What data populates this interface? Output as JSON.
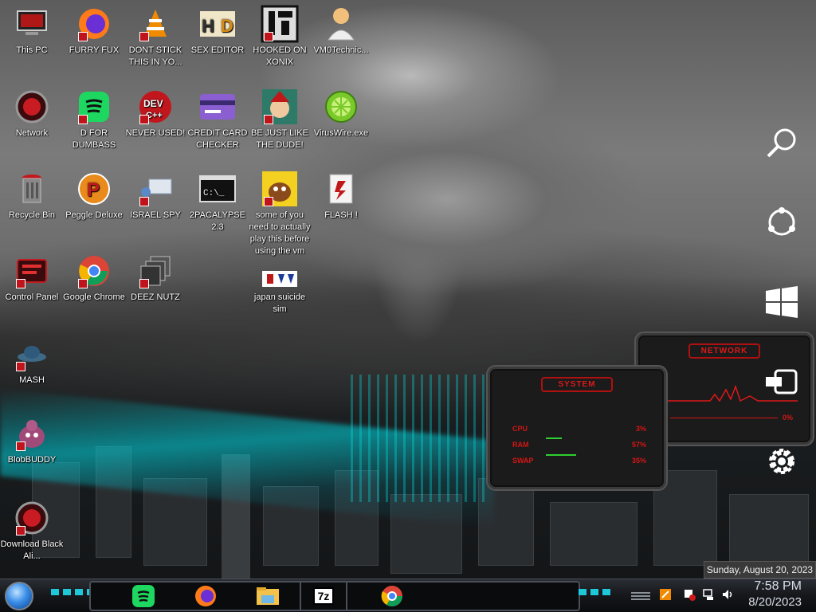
{
  "desktop_icons": [
    {
      "id": "this-pc",
      "label": "This PC"
    },
    {
      "id": "furry-fux",
      "label": "FURRY FUX"
    },
    {
      "id": "dont-stick",
      "label": "DONT STICK THIS IN YO..."
    },
    {
      "id": "sex-editor",
      "label": "SEX EDITOR"
    },
    {
      "id": "hooked-on-xonix",
      "label": "HOOKED ON XONIX"
    },
    {
      "id": "vm0technic",
      "label": "VM0Technic..."
    },
    {
      "id": "network",
      "label": "Network"
    },
    {
      "id": "d-for-dumbass",
      "label": "D FOR DUMBASS"
    },
    {
      "id": "never-used",
      "label": "NEVER USED!"
    },
    {
      "id": "credit-card-checker",
      "label": "CREDIT CARD CHECKER"
    },
    {
      "id": "be-just-like-the-dude",
      "label": "BE JUST LIKE THE DUDE!"
    },
    {
      "id": "viruswire",
      "label": "VirusWire.exe"
    },
    {
      "id": "recycle-bin",
      "label": "Recycle Bin"
    },
    {
      "id": "peggle-deluxe",
      "label": "Peggle Deluxe"
    },
    {
      "id": "israel-spy",
      "label": "ISRAEL SPY"
    },
    {
      "id": "2pacalypse",
      "label": "2PACALYPSE 2.3"
    },
    {
      "id": "some-of-you",
      "label": "some of you need to actually play this before using the vm"
    },
    {
      "id": "flash",
      "label": "FLASH !"
    },
    {
      "id": "control-panel",
      "label": "Control Panel"
    },
    {
      "id": "google-chrome",
      "label": "Google Chrome"
    },
    {
      "id": "deez-nutz",
      "label": "DEEZ NUTZ"
    },
    {
      "id": "japan-suicide-sim",
      "label": "japan suicide sim"
    },
    {
      "id": "mash",
      "label": "MASH"
    },
    {
      "id": "blobbuddy",
      "label": "BlobBUDDY"
    },
    {
      "id": "download-black-ali",
      "label": "Download Black Ali..."
    }
  ],
  "system_gadget": {
    "title": "SYSTEM",
    "rows": [
      {
        "label": "CPU",
        "value": "3%"
      },
      {
        "label": "RAM",
        "value": "57%"
      },
      {
        "label": "SWAP",
        "value": "35%"
      }
    ]
  },
  "network_gadget": {
    "title": "NETWORK",
    "row_label": "T",
    "row_value": "0%"
  },
  "charms": [
    "search-icon",
    "share-icon",
    "windows-start-icon",
    "devices-icon",
    "settings-gear-icon"
  ],
  "taskbar": {
    "pinned": [
      "spotify-icon",
      "firefox-icon",
      "file-explorer-icon",
      "7zip-icon",
      "chrome-icon"
    ],
    "sevenzip_label": "7z"
  },
  "tooltip": "Sunday, August 20, 2023",
  "clock": {
    "time": "7:58 PM",
    "date": "8/20/2023"
  },
  "colors": {
    "gadget_red": "#d51515",
    "clock_text": "#d8dde6"
  }
}
